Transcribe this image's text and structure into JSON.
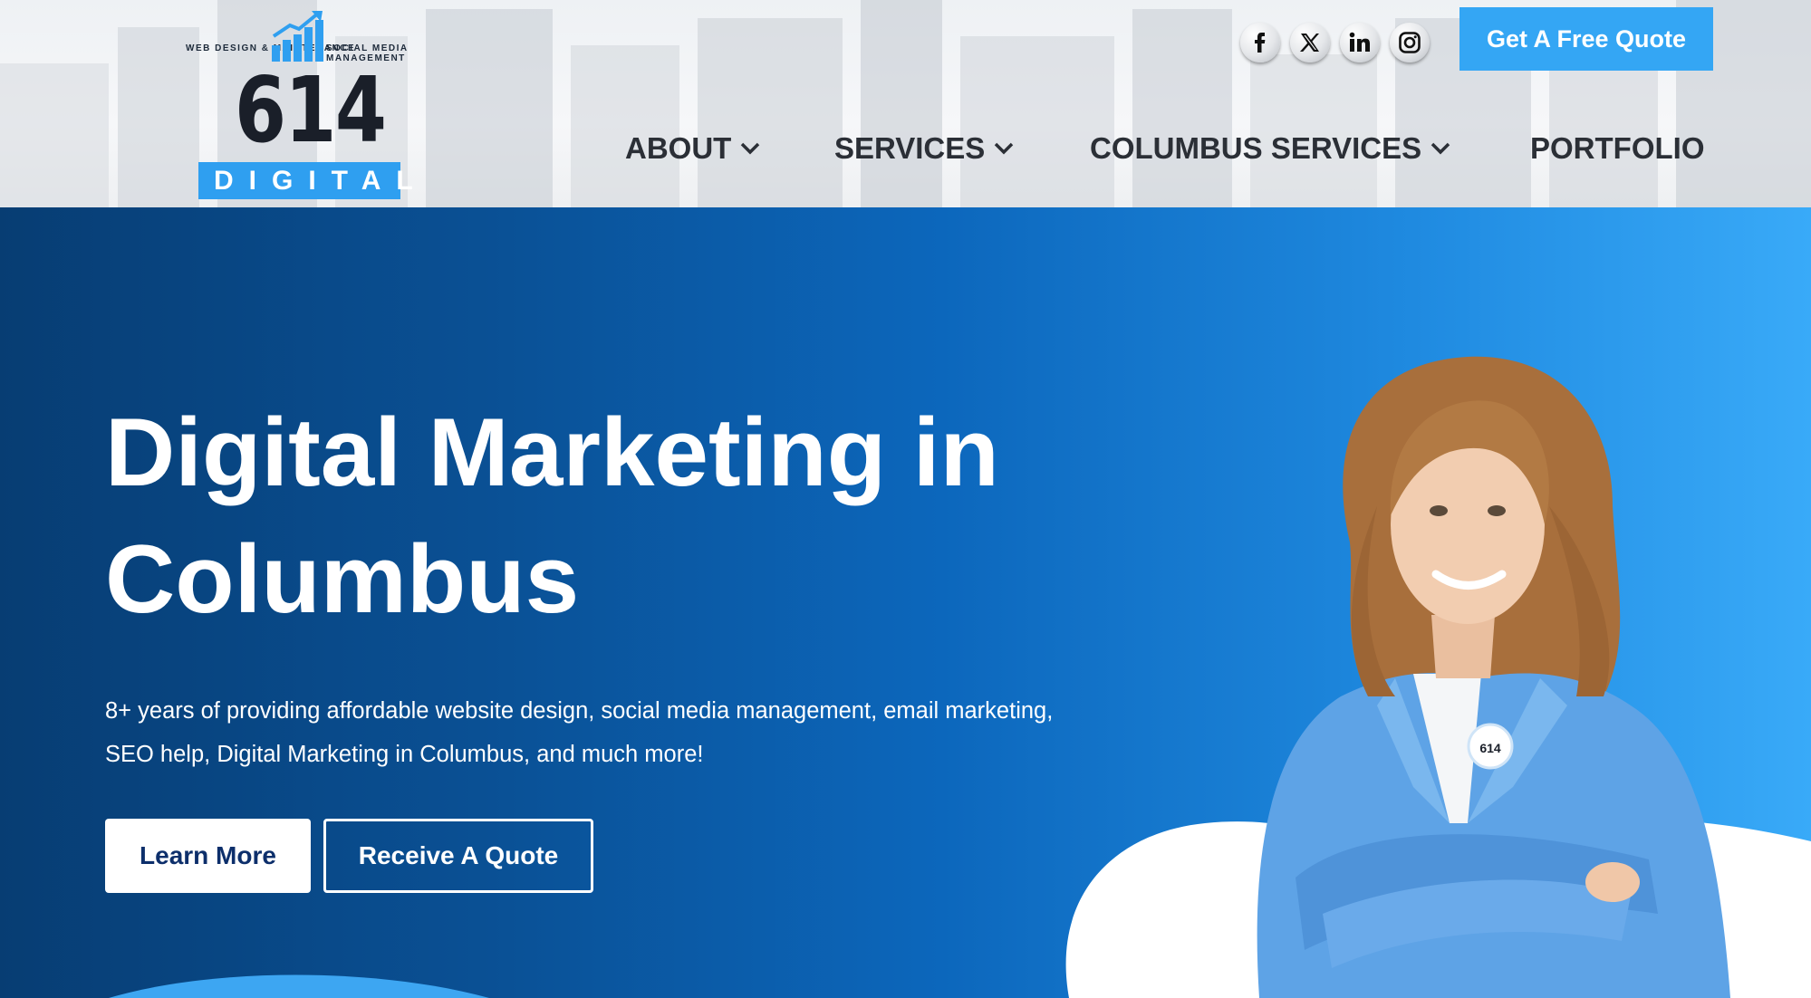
{
  "header": {
    "logo": {
      "tagline_left": "WEB DESIGN & MAINTENANCE",
      "tagline_right": "SOCIAL MEDIA MANAGEMENT",
      "number": "614",
      "wordmark": "DIGITAL"
    },
    "social_icons": [
      "facebook-icon",
      "x-twitter-icon",
      "linkedin-icon",
      "instagram-icon"
    ],
    "cta_label": "Get A Free Quote",
    "nav": {
      "about": "ABOUT",
      "services": "SERVICES",
      "columbus_services": "COLUMBUS SERVICES",
      "portfolio": "PORTFOLIO"
    }
  },
  "hero": {
    "title_line1": "Digital Marketing in",
    "title_line2": "Columbus",
    "subtitle_line1": "8+ years of providing affordable website design, social media management, email marketing,",
    "subtitle_line2": "SEO help, Digital Marketing in Columbus, and much more!",
    "primary_button": "Learn More",
    "secondary_button": "Receive A Quote",
    "badge_text": "614"
  },
  "colors": {
    "accent": "#34a6f4",
    "logo_blue": "#2f9ff0",
    "hero_dark": "#073d73",
    "hero_light": "#39aaf8",
    "nav_text": "#2b2f36",
    "learn_more_text": "#0d2f6b"
  }
}
